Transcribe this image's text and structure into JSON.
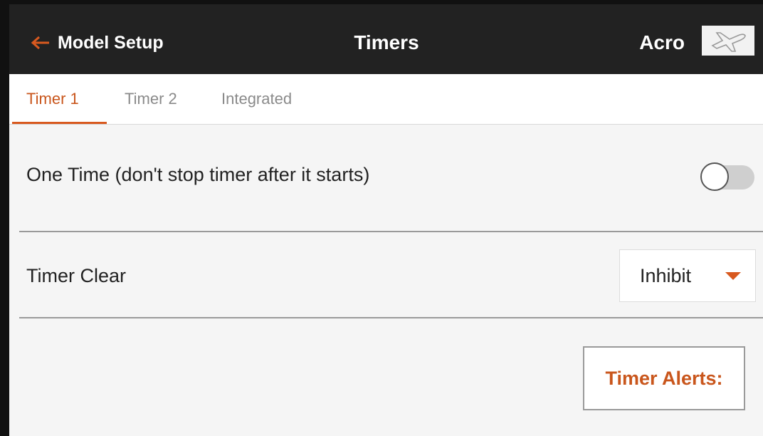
{
  "header": {
    "back_label": "Model Setup",
    "back_icon": "arrow-left-icon",
    "title": "Timers",
    "model_name": "Acro",
    "model_icon": "airplane-icon"
  },
  "tabs": [
    {
      "label": "Timer 1",
      "active": true
    },
    {
      "label": "Timer 2",
      "active": false
    },
    {
      "label": "Integrated",
      "active": false
    }
  ],
  "one_time": {
    "label": "One Time (don't stop timer after it starts)",
    "enabled": false
  },
  "timer_clear": {
    "label": "Timer Clear",
    "value": "Inhibit"
  },
  "timer_alerts_label": "Timer Alerts:",
  "colors": {
    "accent": "#d8591f",
    "topbar": "#222222",
    "background": "#f5f5f5"
  }
}
